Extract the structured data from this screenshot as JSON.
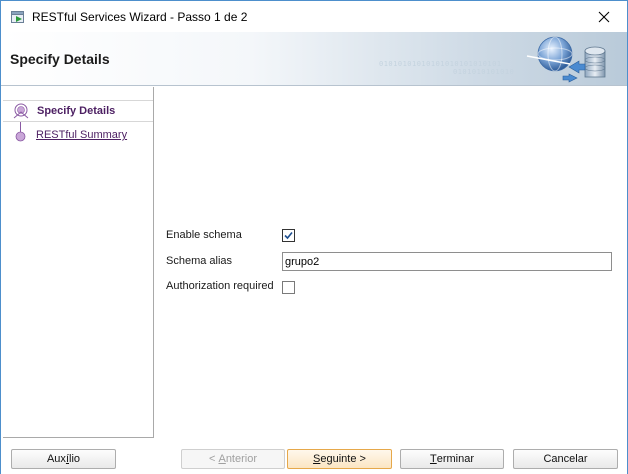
{
  "window": {
    "title": "RESTful Services Wizard - Passo 1 de 2",
    "close_icon": "close-icon",
    "app_icon": "restful-wizard-icon"
  },
  "banner": {
    "title": "Specify Details",
    "binary_line1": "01010101010101010101010101",
    "binary_line2": "0101010101010",
    "art_icon": "globe-database-icon"
  },
  "steps": [
    {
      "label": "Specify Details",
      "state": "active"
    },
    {
      "label": "RESTful Summary",
      "state": "link"
    }
  ],
  "form": {
    "enable_schema": {
      "label": "Enable schema",
      "checked": true
    },
    "schema_alias": {
      "label": "Schema alias",
      "value": "grupo2"
    },
    "authorization_required": {
      "label": "Authorization required",
      "checked": false
    }
  },
  "buttons": {
    "help": {
      "pre": "Aux",
      "mnemonic": "í",
      "post": "lio"
    },
    "back": {
      "pre": "< ",
      "mnemonic": "A",
      "post": "nterior"
    },
    "next": {
      "pre": "",
      "mnemonic": "S",
      "post": "eguinte >"
    },
    "finish": {
      "pre": "",
      "mnemonic": "T",
      "post": "erminar"
    },
    "cancel": {
      "label": "Cancelar"
    }
  },
  "colors": {
    "accent_purple": "#4c1f62",
    "primary_button_border": "#e6a84a",
    "window_border": "#4d8fcc"
  }
}
